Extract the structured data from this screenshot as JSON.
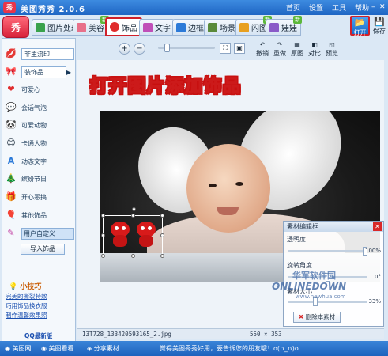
{
  "window": {
    "title": "美图秀秀 2.0.6",
    "logo_text": "秀",
    "menus": [
      "首页",
      "设置",
      "工具",
      "帮助"
    ]
  },
  "tabs": [
    {
      "label": "图片处理",
      "new": false,
      "icon_color": "#3aa24c"
    },
    {
      "label": "美容",
      "new": true,
      "icon_color": "#e8708a"
    },
    {
      "label": "饰品",
      "new": false,
      "active": true,
      "icon_color": "#e02c2c"
    },
    {
      "label": "文字",
      "new": false,
      "icon_color": "#c04fb8"
    },
    {
      "label": "边框",
      "new": false,
      "icon_color": "#2c7ad8"
    },
    {
      "label": "场景",
      "new": false,
      "icon_color": "#5a8a3a"
    },
    {
      "label": "闪图",
      "new": true,
      "icon_color": "#e8a020"
    },
    {
      "label": "娃娃",
      "new": true,
      "icon_color": "#8a5ac8"
    }
  ],
  "new_badge": "新",
  "toolbar_right": {
    "open_label": "打开",
    "save_label": "保存"
  },
  "sidebar": {
    "items": [
      {
        "label": "非主流印",
        "icon": "lips-icon",
        "glyph": "💋",
        "chevron": false
      },
      {
        "label": "装饰品",
        "icon": "bow-icon",
        "glyph": "🎀",
        "chevron": true
      },
      {
        "label": "可爱心",
        "icon": "heart-icon",
        "glyph": "❤",
        "chevron": false
      },
      {
        "label": "会话气泡",
        "icon": "speech-bubble-icon",
        "glyph": "💬",
        "chevron": false
      },
      {
        "label": "可爱动物",
        "icon": "animal-icon",
        "glyph": "🐼",
        "chevron": false
      },
      {
        "label": "卡通人物",
        "icon": "cartoon-person-icon",
        "glyph": "😊",
        "chevron": false
      },
      {
        "label": "动态文字",
        "icon": "animated-text-icon",
        "glyph": "A",
        "chevron": false
      },
      {
        "label": "缤纷节日",
        "icon": "festival-icon",
        "glyph": "🎄",
        "chevron": false
      },
      {
        "label": "开心恶搞",
        "icon": "funny-icon",
        "glyph": "🎁",
        "chevron": false
      },
      {
        "label": "其他饰品",
        "icon": "other-accessory-icon",
        "glyph": "🎈",
        "chevron": false
      },
      {
        "label": "用户自定义",
        "icon": "custom-icon",
        "glyph": "✎",
        "chevron": false,
        "selected": true
      }
    ],
    "import_label": "导入饰品",
    "tips_title": "小技巧",
    "tips": [
      "完美的撕裂特效",
      "巧用饰品换衣服",
      "制作温馨效果照"
    ],
    "qq_link": "QQ最新版"
  },
  "toolbar": {
    "zoom_in": "+",
    "zoom_out": "−",
    "zoom_level": 0.12,
    "buttons": [
      "撤销",
      "重做",
      "原图",
      "对比",
      "预览"
    ]
  },
  "headline": "打开图片添加饰品",
  "material_panel": {
    "title": "素材编辑框",
    "transparency_label": "透明度",
    "transparency_value": "100%",
    "transparency_level": 1.0,
    "rotation_label": "旋转角度",
    "rotation_value": "0°",
    "rotation_level": 0.5,
    "size_label": "素材大小",
    "size_value": "33%",
    "size_level": 0.33,
    "delete_label": "删除本素材"
  },
  "watermark": {
    "cn": "华军软件园",
    "en": "ONLINEDOWN",
    "url": "www.newhua.com"
  },
  "file_info": {
    "filename": "13T728_133420593165_2.jpg",
    "dimensions": "550 × 353"
  },
  "statusbar": {
    "links": [
      "美图网",
      "美图看看",
      "分享素材"
    ],
    "message": "觉得美图秀秀好用，要告诉您的朋友哦！o(∩_∩)o..."
  }
}
